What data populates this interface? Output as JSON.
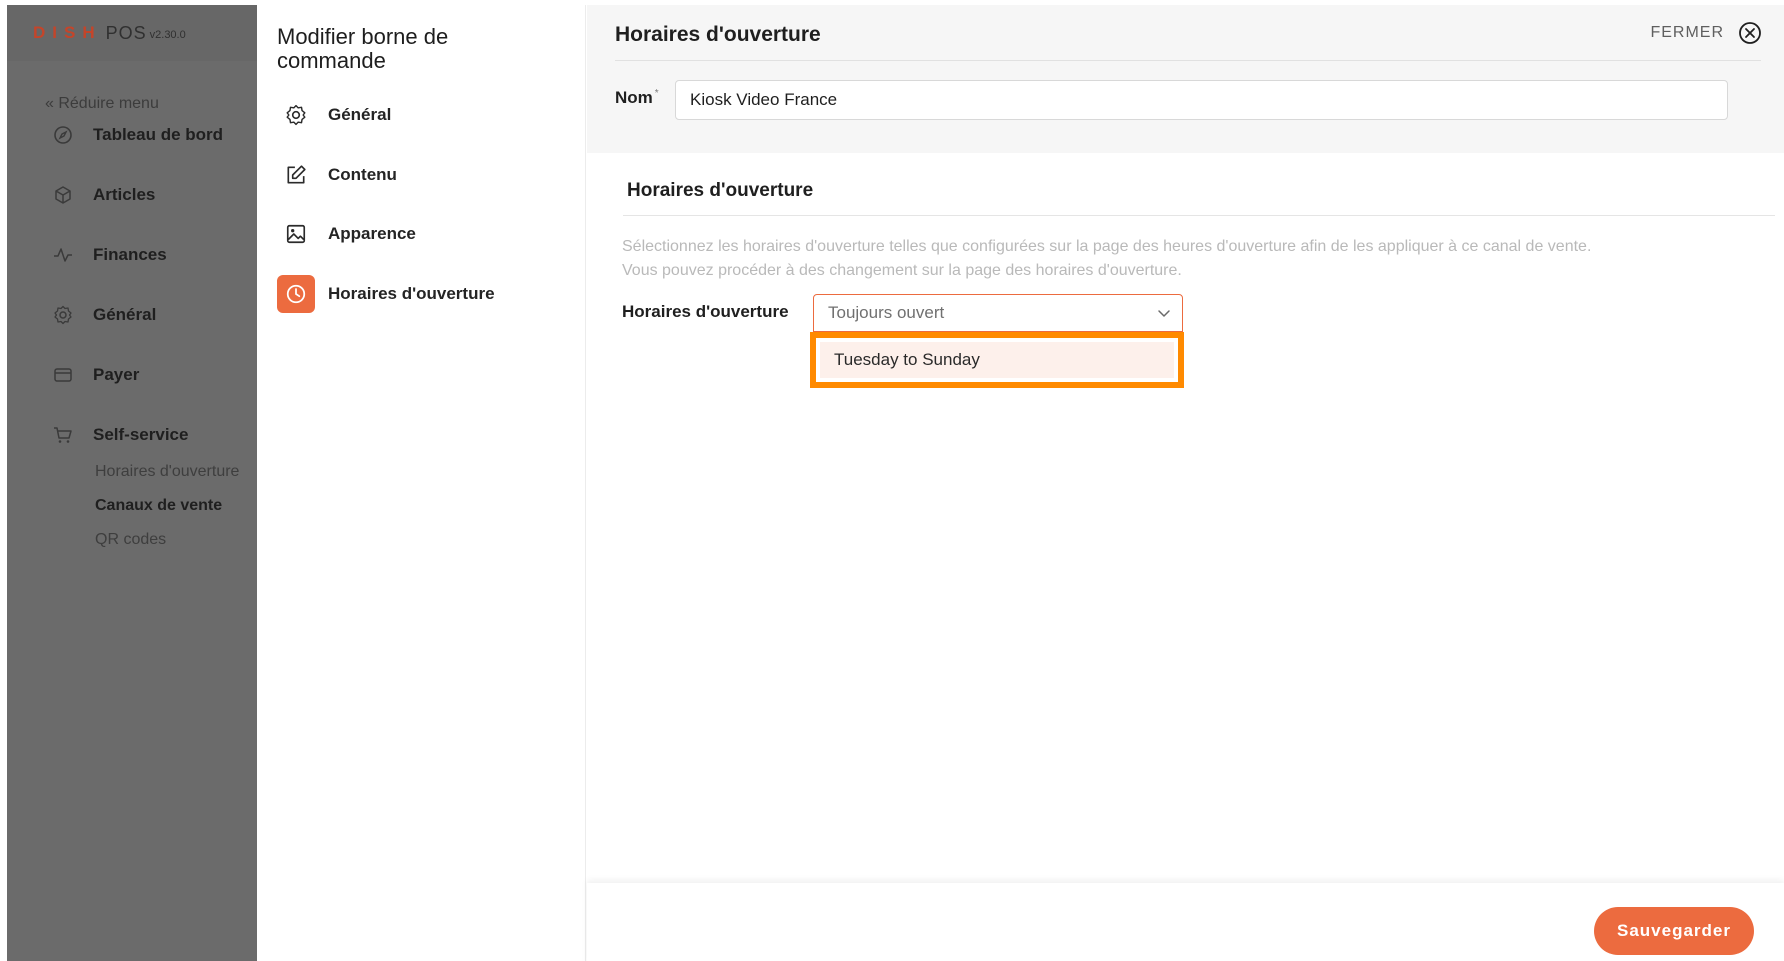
{
  "brand": {
    "dish": "DISH",
    "pos": "POS",
    "version": "v2.30.0"
  },
  "sidebar": {
    "collapse_label": "« Réduire menu",
    "items": [
      {
        "label": "Tableau de bord",
        "icon": "compass-icon"
      },
      {
        "label": "Articles",
        "icon": "box-icon"
      },
      {
        "label": "Finances",
        "icon": "activity-icon"
      },
      {
        "label": "Général",
        "icon": "gear-icon"
      },
      {
        "label": "Payer",
        "icon": "credit-card-icon"
      },
      {
        "label": "Self-service",
        "icon": "cart-icon"
      }
    ],
    "subitems": [
      {
        "label": "Horaires d'ouverture"
      },
      {
        "label": "Canaux de vente"
      },
      {
        "label": "QR codes"
      }
    ]
  },
  "editor": {
    "title": "Modifier borne de commande",
    "menu": [
      {
        "label": "Général",
        "icon": "gear-icon"
      },
      {
        "label": "Contenu",
        "icon": "edit-icon"
      },
      {
        "label": "Apparence",
        "icon": "image-icon"
      },
      {
        "label": "Horaires d'ouverture",
        "icon": "clock-icon",
        "active": true
      }
    ]
  },
  "content": {
    "title": "Horaires d'ouverture",
    "close_label": "FERMER",
    "name_label": "Nom",
    "name_required": "*",
    "name_value": "Kiosk Video France",
    "section_title": "Horaires d'ouverture",
    "section_desc_1": "Sélectionnez les horaires d'ouverture telles que configurées sur la page des heures d'ouverture afin de les appliquer à ce canal de vente.",
    "section_desc_2": "Vous pouvez procéder à des changement sur la page des horaires d'ouverture.",
    "field_label": "Horaires d'ouverture",
    "select_value": "Toujours ouvert",
    "dropdown_options": [
      "Tuesday to Sunday"
    ],
    "save_label": "Sauvegarder"
  },
  "colors": {
    "accent": "#ec6b3f",
    "highlight": "#ff8a00",
    "sidebar_bg": "#6b6b6b"
  }
}
